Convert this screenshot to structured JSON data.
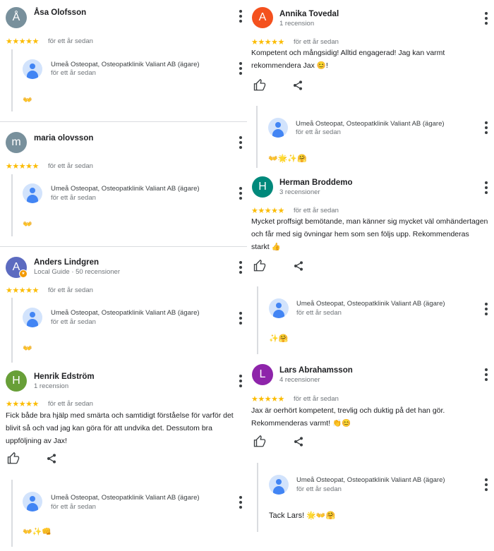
{
  "colors": {
    "star": "#fbbc04",
    "owner_avatar": "#4285f4",
    "divider": "#dadce0"
  },
  "left": [
    {
      "avatar_letter": "Å",
      "avatar_color": "#78909c",
      "name": "Åsa Olofsson",
      "sub": "",
      "stars": "★★★★★",
      "date": "för ett år sedan",
      "text": "",
      "owner": {
        "name": "Umeå Osteopat, Osteopatklinik Valiant AB (ägare)",
        "date": "för ett år sedan",
        "reply": "👐"
      }
    },
    {
      "avatar_letter": "m",
      "avatar_color": "#78909c",
      "name": "maria olovsson",
      "sub": "",
      "stars": "★★★★★",
      "date": "för ett år sedan",
      "text": "",
      "owner": {
        "name": "Umeå Osteopat, Osteopatklinik Valiant AB (ägare)",
        "date": "för ett år sedan",
        "reply": "👐"
      }
    },
    {
      "avatar_letter": "A",
      "avatar_color": "#5c6bc0",
      "name": "Anders Lindgren",
      "sub": "Local Guide · 50 recensioner",
      "stars": "★★★★★",
      "date": "för ett år sedan",
      "text": "",
      "owner": {
        "name": "Umeå Osteopat, Osteopatklinik Valiant AB (ägare)",
        "date": "för ett år sedan",
        "reply": "👐"
      }
    },
    {
      "avatar_letter": "H",
      "avatar_color": "#689f38",
      "name": "Henrik Edström",
      "sub": "1 recension",
      "stars": "★★★★★",
      "date": "för ett år sedan",
      "text": "Fick både bra hjälp med smärta och samtidigt förståelse för varför det blivit så och vad jag kan göra för att undvika det. Dessutom bra uppföljning av Jax!",
      "owner": {
        "name": "Umeå Osteopat, Osteopatklinik Valiant AB (ägare)",
        "date": "för ett år sedan",
        "reply": "👐✨👊"
      }
    }
  ],
  "right": [
    {
      "avatar_letter": "A",
      "avatar_color": "#f4511e",
      "name": "Annika Tovedal",
      "sub": "1 recension",
      "stars": "★★★★★",
      "date": "för ett år sedan",
      "text": "Kompetent och mångsidig!  Alltid engagerad! Jag kan varmt rekommendera Jax 😊!",
      "owner": {
        "name": "Umeå Osteopat, Osteopatklinik Valiant AB (ägare)",
        "date": "för ett år sedan",
        "reply": "👐🌟✨🤗"
      }
    },
    {
      "avatar_letter": "H",
      "avatar_color": "#00897b",
      "name": "Herman Broddemo",
      "sub": "3 recensioner",
      "stars": "★★★★★",
      "date": "för ett år sedan",
      "text": "Mycket proffsigt bemötande, man känner sig mycket väl omhändertagen och får med sig övningar hem som sen följs upp. Rekommenderas starkt 👍",
      "owner": {
        "name": "Umeå Osteopat, Osteopatklinik Valiant AB (ägare)",
        "date": "för ett år sedan",
        "reply": "✨🤗"
      }
    },
    {
      "avatar_letter": "L",
      "avatar_color": "#8e24aa",
      "name": "Lars Abrahamsson",
      "sub": "4 recensioner",
      "stars": "★★★★★",
      "date": "för ett år sedan",
      "text": "Jax är oerhört kompetent, trevlig och duktig på det han gör. Rekommenderas varmt! 👏😊",
      "owner": {
        "name": "Umeå Osteopat, Osteopatklinik Valiant AB (ägare)",
        "date": "för ett år sedan",
        "reply": "Tack Lars! 🌟👐🤗"
      }
    }
  ]
}
